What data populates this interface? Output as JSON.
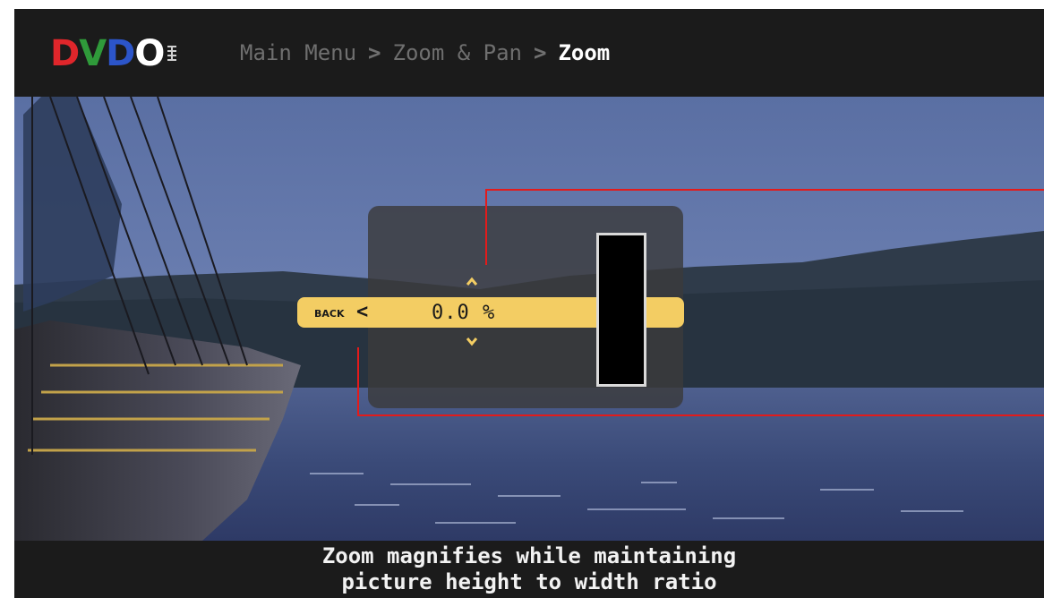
{
  "logo": {
    "letters": [
      "D",
      "V",
      "D",
      "O"
    ],
    "colors": [
      "#e0262b",
      "#2f9a3a",
      "#2c55c9",
      "#ffffff"
    ],
    "mark": "Ⅲ"
  },
  "breadcrumb": {
    "items": [
      "Main Menu",
      "Zoom & Pan"
    ],
    "separator": ">",
    "current": "Zoom"
  },
  "osd": {
    "back_label": "BACK",
    "back_icon": "chevron-left-icon",
    "back_glyph": "<",
    "value": "0.0 %",
    "up_glyph": "⌃",
    "down_glyph": "⌄",
    "accent_color": "#f3cd63"
  },
  "footer": {
    "line1": "Zoom magnifies while maintaining",
    "line2": "picture height to width ratio"
  },
  "callout_color": "#e31b1b"
}
